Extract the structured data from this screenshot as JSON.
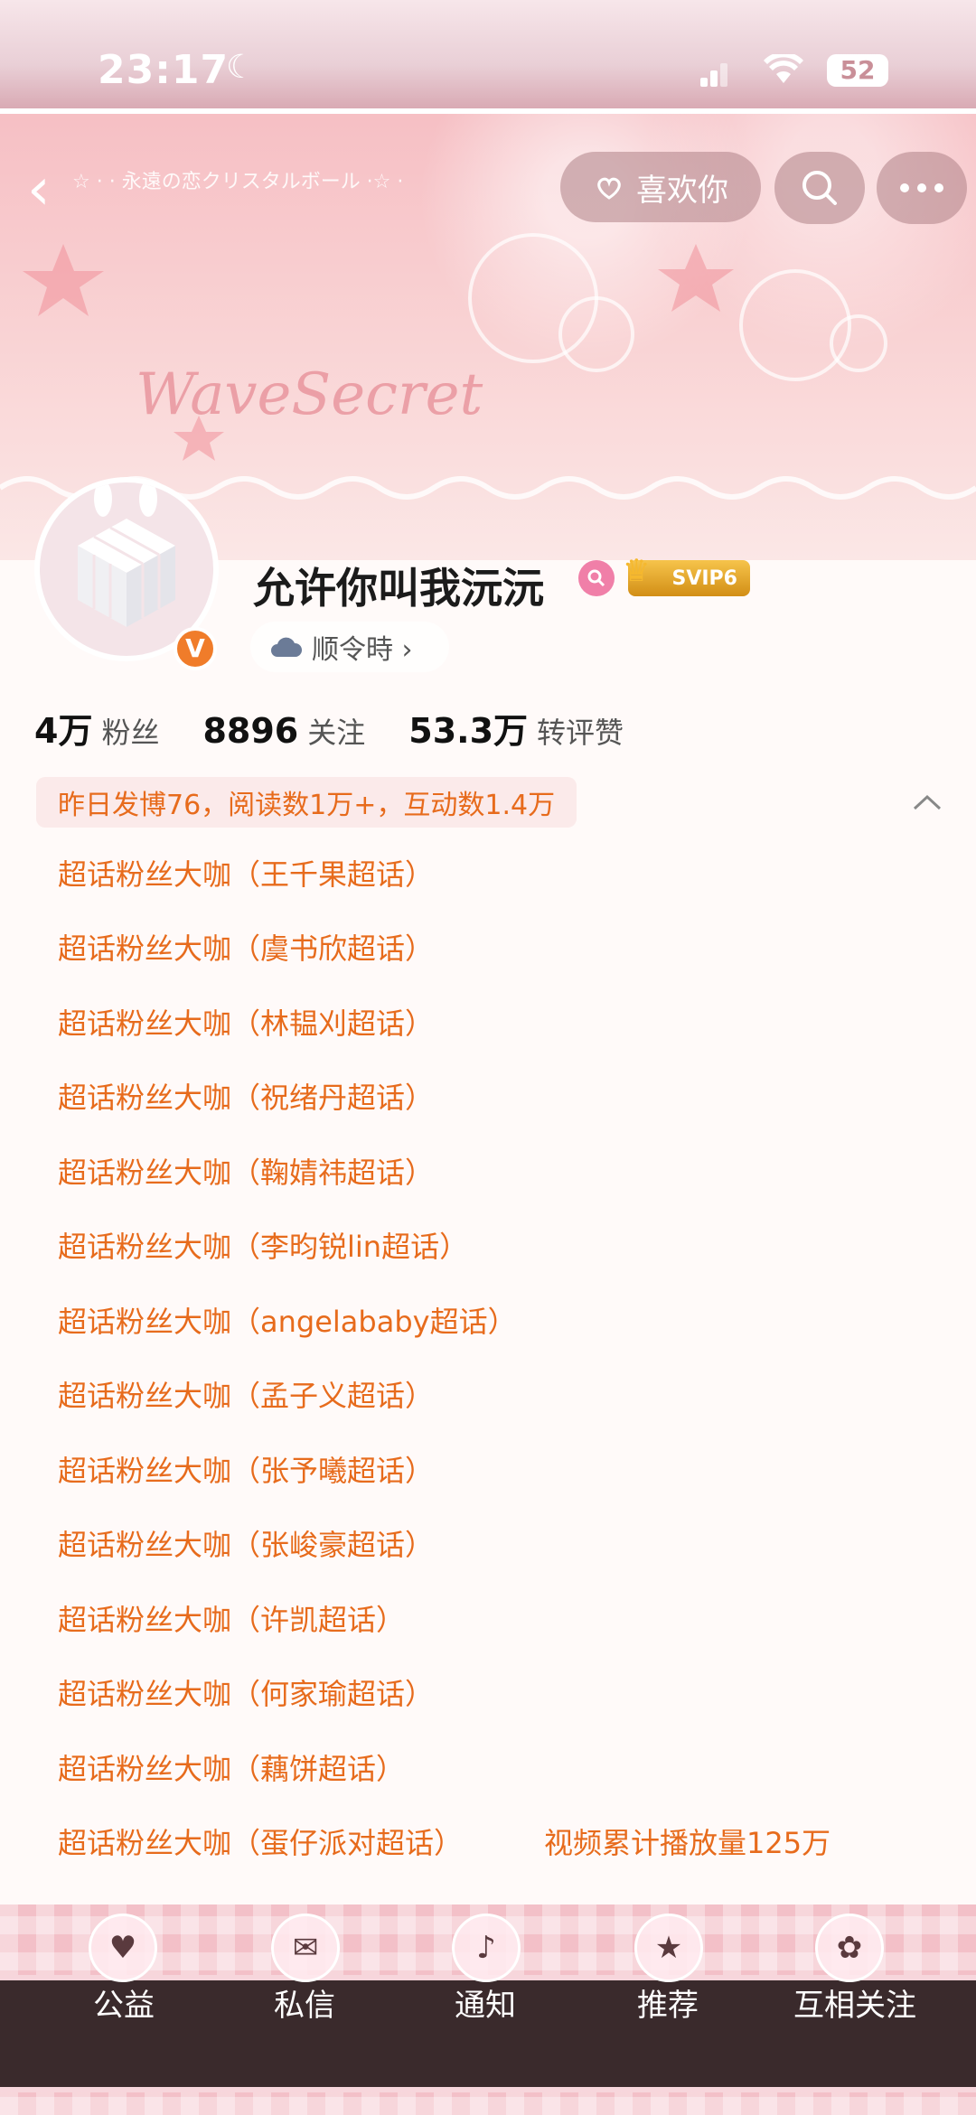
{
  "status_bar": {
    "time": "23:17",
    "battery": "52"
  },
  "header": {
    "banner_caption": "☆ · · 永遠の恋クリスタルボール ·☆ ·",
    "banner_decor_text": "WaveSecret",
    "like_label": "喜欢你"
  },
  "profile": {
    "name": "允许你叫我沅沅",
    "vip": "SVIP6",
    "verify_mark": "V",
    "weather_label": "顺令時 ›"
  },
  "stats": [
    {
      "value": "4万",
      "label": "粉丝"
    },
    {
      "value": "8896",
      "label": "关注"
    },
    {
      "value": "53.3万",
      "label": "转评赞"
    }
  ],
  "summary": "昨日发博76，阅读数1万+，互动数1.4万",
  "honors": [
    "超话粉丝大咖（王千果超话）",
    "超话粉丝大咖（虞书欣超话）",
    "超话粉丝大咖（林韫刈超话）",
    "超话粉丝大咖（祝绪丹超话）",
    "超话粉丝大咖（鞠婧祎超话）",
    "超话粉丝大咖（李昀锐lin超话）",
    "超话粉丝大咖（angelababy超话）",
    "超话粉丝大咖（孟子义超话）",
    "超话粉丝大咖（张予曦超话）",
    "超话粉丝大咖（张峻豪超话）",
    "超话粉丝大咖（许凯超话）",
    "超话粉丝大咖（何家瑜超话）",
    "超话粉丝大咖（藕饼超话）",
    "超话粉丝大咖（蛋仔派对超话）"
  ],
  "video_plays": "视频累计播放量125万",
  "bottom_tabs": [
    "公益",
    "私信",
    "通知",
    "推荐",
    "互相关注"
  ],
  "colors": {
    "accent": "#e76b1c",
    "banner": "#f3b6bc",
    "vip": "#f6c44b"
  }
}
